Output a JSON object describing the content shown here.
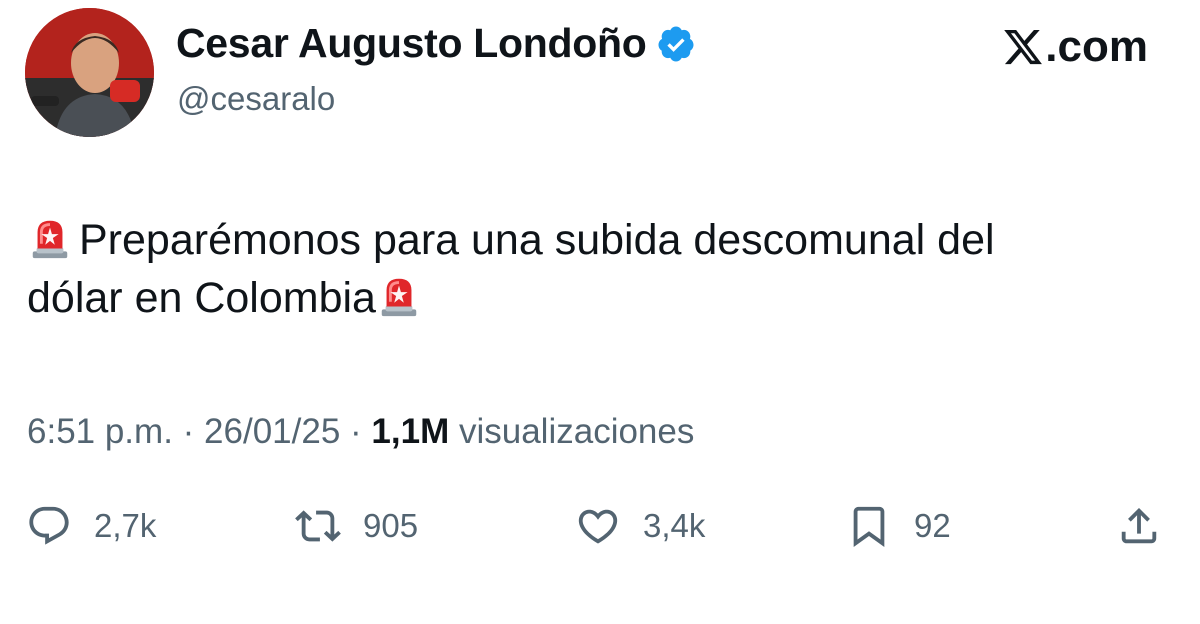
{
  "author": {
    "name": "Cesar Augusto Londoño",
    "handle": "@cesaralo",
    "verified_color": "#1d9bf0"
  },
  "brand": {
    "label": ".com",
    "icon": "x-logo-icon"
  },
  "tweet": {
    "text_line1": "Preparémonos para una subida descomunal del",
    "text_line2": "dólar en Colombia",
    "emoji": "rotating-light-emoji"
  },
  "meta": {
    "time": "6:51 p.m.",
    "separator": "·",
    "date": "26/01/25",
    "views_count": "1,1M",
    "views_label": "visualizaciones"
  },
  "actions": {
    "replies": "2,7k",
    "retweets": "905",
    "likes": "3,4k",
    "bookmarks": "92"
  },
  "colors": {
    "text": "#0f1419",
    "muted": "#536471",
    "accent": "#1d9bf0",
    "siren_red": "#e0262a"
  }
}
